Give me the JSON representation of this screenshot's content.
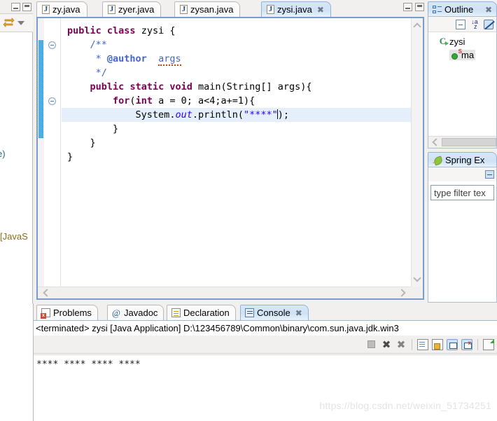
{
  "left_panel": {
    "fragment_top": "e)",
    "fragment_bottom": "[JavaS",
    "link_icon": "link-with-editor-icon",
    "menu_icon": "view-menu-chevron-icon"
  },
  "editor": {
    "tabs": [
      {
        "label": "zy.java",
        "active": false,
        "icon": "java-file-icon"
      },
      {
        "label": "zyer.java",
        "active": false,
        "icon": "java-file-icon"
      },
      {
        "label": "zysan.java",
        "active": false,
        "icon": "java-file-icon"
      },
      {
        "label": "zysi.java",
        "active": true,
        "icon": "java-file-icon",
        "close": "✖"
      }
    ],
    "minimize_label": "",
    "maximize_label": "",
    "code_lines": [
      {
        "id": 1,
        "highlight": false,
        "tokens": [
          {
            "t": "public",
            "c": "kw"
          },
          {
            "t": " ",
            "c": "plain"
          },
          {
            "t": "class",
            "c": "kw"
          },
          {
            "t": " zysi {",
            "c": "plain"
          }
        ]
      },
      {
        "id": 2,
        "highlight": false,
        "indent": 1,
        "tokens": [
          {
            "t": "/**",
            "c": "cmt"
          }
        ]
      },
      {
        "id": 3,
        "highlight": false,
        "indent": 1,
        "tokens": [
          {
            "t": " * ",
            "c": "cmt"
          },
          {
            "t": "@author",
            "c": "jdoc-tag"
          },
          {
            "t": "  ",
            "c": "cmt"
          },
          {
            "t": "args",
            "c": "cmt squig"
          }
        ]
      },
      {
        "id": 4,
        "highlight": false,
        "indent": 1,
        "tokens": [
          {
            "t": " */",
            "c": "cmt"
          }
        ]
      },
      {
        "id": 5,
        "highlight": false,
        "indent": 1,
        "tokens": [
          {
            "t": "public",
            "c": "kw"
          },
          {
            "t": " ",
            "c": "plain"
          },
          {
            "t": "static",
            "c": "kw"
          },
          {
            "t": " ",
            "c": "plain"
          },
          {
            "t": "void",
            "c": "kw"
          },
          {
            "t": " main(String[] args){",
            "c": "plain"
          }
        ]
      },
      {
        "id": 6,
        "highlight": false,
        "indent": 2,
        "tokens": [
          {
            "t": "for",
            "c": "kw"
          },
          {
            "t": "(",
            "c": "plain"
          },
          {
            "t": "int",
            "c": "kw"
          },
          {
            "t": " a = ",
            "c": "plain"
          },
          {
            "t": "0",
            "c": "plain"
          },
          {
            "t": "; a<4;a+=1){",
            "c": "plain"
          }
        ]
      },
      {
        "id": 7,
        "highlight": true,
        "indent": 3,
        "tokens": [
          {
            "t": "System.",
            "c": "plain"
          },
          {
            "t": "out",
            "c": "fld"
          },
          {
            "t": ".println(",
            "c": "plain"
          },
          {
            "t": "\"****\"",
            "c": "str"
          },
          {
            "t": "CARET",
            "c": "caret"
          },
          {
            "t": ");",
            "c": "plain"
          }
        ]
      },
      {
        "id": 8,
        "highlight": false,
        "indent": 2,
        "tokens": [
          {
            "t": "}",
            "c": "plain"
          }
        ]
      },
      {
        "id": 9,
        "highlight": false,
        "indent": 1,
        "tokens": [
          {
            "t": "}",
            "c": "plain"
          }
        ]
      },
      {
        "id": 10,
        "highlight": false,
        "indent": 0,
        "tokens": [
          {
            "t": "}",
            "c": "plain"
          }
        ]
      }
    ],
    "folding_markers": [
      "collapse-javadoc",
      "collapse-method"
    ],
    "scroll_up_icon": "chevron-up-icon",
    "scroll_down_icon": "chevron-down-icon",
    "scroll_left_icon": "chevron-left-icon",
    "scroll_right_icon": "chevron-right-icon"
  },
  "outline": {
    "title": "Outline",
    "close": "✖",
    "toolbar": [
      "collapse-all-icon",
      "sort-alphabetically-icon",
      "hide-fields-icon"
    ],
    "tree": [
      {
        "label": "zysi",
        "icon": "java-class-icon",
        "level": 0,
        "selected": false
      },
      {
        "label": "ma",
        "icon": "static-method-icon",
        "level": 1,
        "selected": true
      }
    ]
  },
  "spring_explorer": {
    "title": "Spring Ex",
    "filter_placeholder": "type filter tex",
    "toolbar": [
      "view-menu-icon"
    ]
  },
  "bottom": {
    "tabs": [
      {
        "label": "Problems",
        "active": false,
        "icon": "problems-icon"
      },
      {
        "label": "Javadoc",
        "active": false,
        "icon": "javadoc-icon"
      },
      {
        "label": "Declaration",
        "active": false,
        "icon": "declaration-icon"
      },
      {
        "label": "Console",
        "active": true,
        "icon": "console-icon",
        "close": "✖"
      }
    ],
    "status_line": "<terminated> zysi [Java Application] D:\\123456789\\Common\\binary\\com.sun.java.jdk.win3",
    "toolbar_icons": [
      "terminate-icon",
      "remove-launch-icon",
      "remove-all-launches-icon",
      "clear-console-icon",
      "scroll-lock-icon",
      "show-console-on-output-icon",
      "show-console-on-error-icon",
      "open-console-icon"
    ],
    "console_output": "****\n****\n****\n****"
  },
  "watermark": "https://blog.csdn.net/weixin_51734251"
}
